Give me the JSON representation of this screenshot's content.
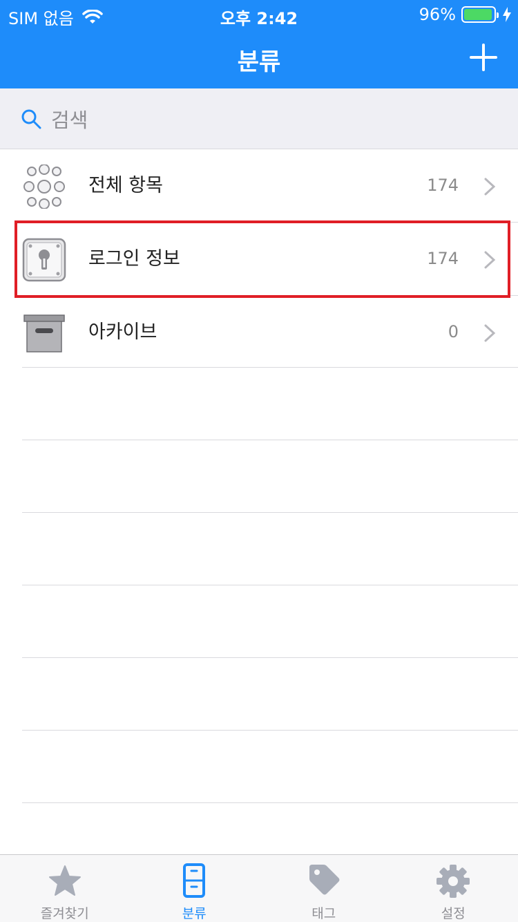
{
  "status_bar": {
    "carrier": "SIM 없음",
    "time": "오후 2:42",
    "battery_percent": "96%",
    "battery_level": 0.96
  },
  "nav": {
    "title": "분류",
    "add_icon": "plus-icon"
  },
  "search": {
    "placeholder": "검색",
    "icon": "search-icon"
  },
  "categories": [
    {
      "label": "전체 항목",
      "count": "174",
      "icon": "all-items-icon"
    },
    {
      "label": "로그인 정보",
      "count": "174",
      "icon": "keyhole-safe-icon"
    },
    {
      "label": "아카이브",
      "count": "0",
      "icon": "archive-box-icon"
    }
  ],
  "tabs": [
    {
      "label": "즐겨찾기",
      "icon": "star-icon",
      "active": false
    },
    {
      "label": "분류",
      "icon": "cabinet-icon",
      "active": true
    },
    {
      "label": "태그",
      "icon": "tag-icon",
      "active": false
    },
    {
      "label": "설정",
      "icon": "gear-icon",
      "active": false
    }
  ],
  "colors": {
    "accent": "#1e8cfa",
    "highlight": "#e01e26",
    "tab_inactive": "#8e8e93"
  }
}
